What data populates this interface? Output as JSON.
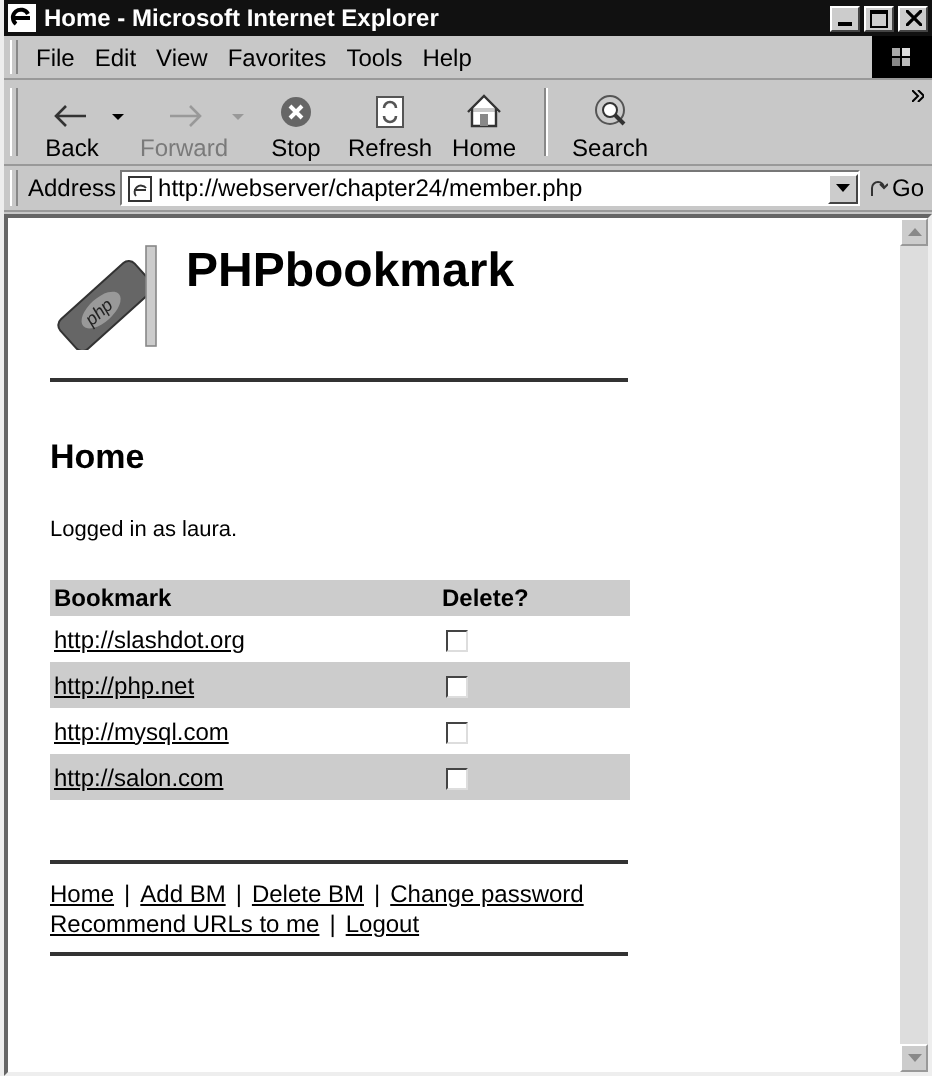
{
  "window": {
    "title": "Home - Microsoft Internet Explorer"
  },
  "menu": [
    "File",
    "Edit",
    "View",
    "Favorites",
    "Tools",
    "Help"
  ],
  "toolbar": [
    {
      "kind": "back",
      "label": "Back",
      "disabled": false,
      "dropdown": true
    },
    {
      "kind": "forward",
      "label": "Forward",
      "disabled": true,
      "dropdown": true
    },
    {
      "kind": "stop",
      "label": "Stop",
      "disabled": false,
      "dropdown": false
    },
    {
      "kind": "refresh",
      "label": "Refresh",
      "disabled": false,
      "dropdown": false
    },
    {
      "kind": "home",
      "label": "Home",
      "disabled": false,
      "dropdown": false
    },
    {
      "kind": "search",
      "label": "Search",
      "disabled": false,
      "dropdown": false
    }
  ],
  "address_bar": {
    "label": "Address",
    "value": "http://webserver/chapter24/member.php",
    "go": "Go"
  },
  "page": {
    "site_title": "PHPbookmark",
    "logo_text": "php",
    "heading": "Home",
    "status": "Logged in as laura.",
    "table": {
      "columns": [
        "Bookmark",
        "Delete?"
      ],
      "rows": [
        {
          "url": "http://slashdot.org",
          "checked": false
        },
        {
          "url": "http://php.net",
          "checked": false
        },
        {
          "url": "http://mysql.com",
          "checked": false
        },
        {
          "url": "http://salon.com",
          "checked": false
        }
      ]
    },
    "footer": [
      [
        {
          "kind": "link",
          "text": "Home"
        },
        {
          "kind": "separator",
          "text": "|"
        },
        {
          "kind": "link",
          "text": "Add BM"
        },
        {
          "kind": "separator",
          "text": "|"
        },
        {
          "kind": "link",
          "text": "Delete BM"
        },
        {
          "kind": "separator",
          "text": "|"
        },
        {
          "kind": "link",
          "text": "Change password"
        }
      ],
      [
        {
          "kind": "link",
          "text": "Recommend URLs to me"
        },
        {
          "kind": "separator",
          "text": "|"
        },
        {
          "kind": "link",
          "text": "Logout"
        }
      ]
    ]
  }
}
